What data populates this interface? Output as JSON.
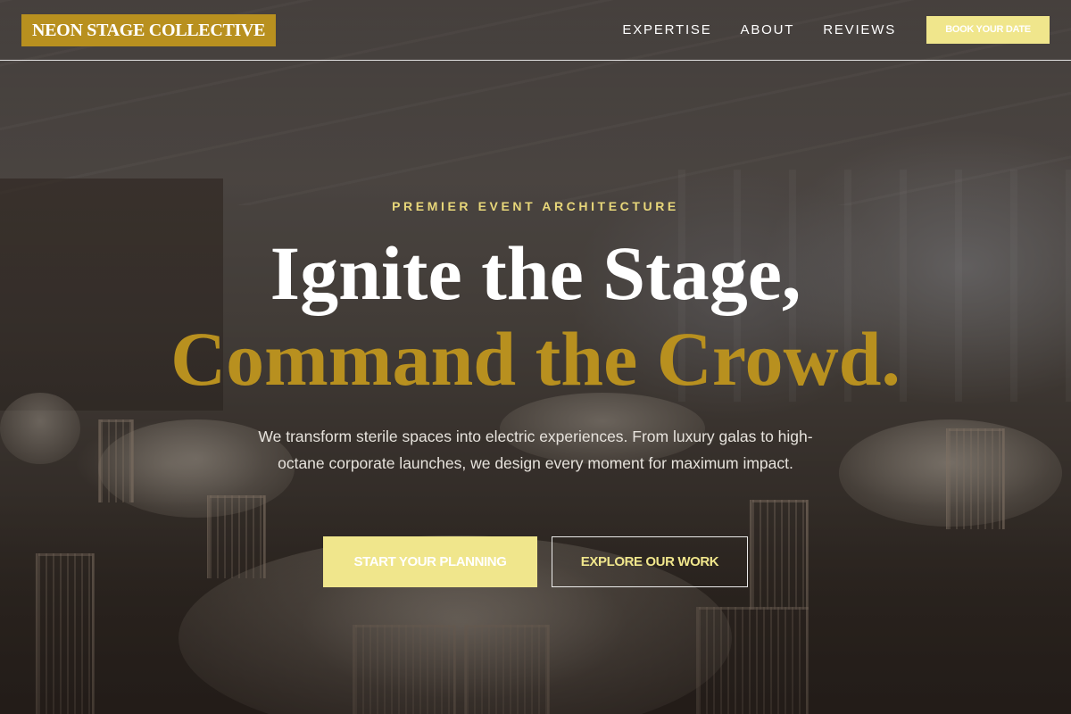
{
  "header": {
    "logo_text": "NEON STAGE COLLECTIVE",
    "nav": [
      {
        "label": "EXPERTISE"
      },
      {
        "label": "ABOUT"
      },
      {
        "label": "REVIEWS"
      }
    ],
    "cta_label": "BOOK YOUR DATE"
  },
  "hero": {
    "eyebrow": "PREMIER EVENT ARCHITECTURE",
    "title_line_1": "Ignite the Stage,",
    "title_line_2": "Command the Crowd.",
    "subtitle": "We transform sterile spaces into electric experiences. From luxury galas to high-octane corporate launches, we design every moment for maximum impact.",
    "primary_button": "START YOUR PLANNING",
    "secondary_button": "EXPLORE OUR WORK"
  },
  "colors": {
    "brand_gold": "#b8901f",
    "accent_yellow": "#f0e68c",
    "eyebrow_gold": "#e8d77a"
  }
}
